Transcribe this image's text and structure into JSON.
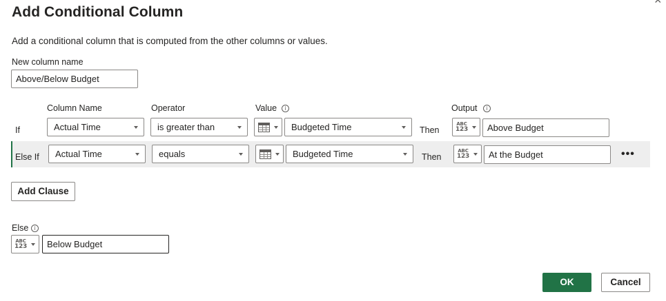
{
  "dialog": {
    "title": "Add Conditional Column",
    "close_glyph": "×",
    "description": "Add a conditional column that is computed from the other columns or values.",
    "new_column": {
      "label": "New column name",
      "value": "Above/Below Budget"
    }
  },
  "headers": {
    "column_name": "Column Name",
    "operator": "Operator",
    "value": "Value",
    "output": "Output"
  },
  "clauses": [
    {
      "keyword": "If",
      "column": "Actual Time",
      "operator": "is greater than",
      "value": "Budgeted Time",
      "then": "Then",
      "output": "Above Budget"
    },
    {
      "keyword": "Else If",
      "column": "Actual Time",
      "operator": "equals",
      "value": "Budgeted Time",
      "then": "Then",
      "output": "At the Budget"
    }
  ],
  "type_icon": {
    "abc": "ABC",
    "num": "123",
    "info": "i"
  },
  "add_clause_label": "Add Clause",
  "more_label": "•••",
  "else": {
    "label": "Else",
    "value": "Below Budget"
  },
  "buttons": {
    "ok": "OK",
    "cancel": "Cancel"
  },
  "colors": {
    "accent": "#217346",
    "highlight_row": "#eeeeee",
    "border": "#8a8886"
  }
}
